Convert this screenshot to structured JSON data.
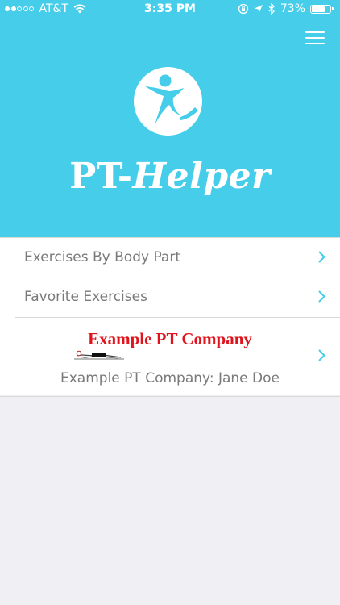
{
  "status_bar": {
    "carrier": "AT&T",
    "signal_bars_filled": 2,
    "signal_bars_total": 5,
    "time": "3:35 PM",
    "battery_percent": "73%",
    "battery_level": 0.73,
    "icons": [
      "wifi-icon",
      "rotation-lock-icon",
      "location-arrow-icon",
      "bluetooth-icon",
      "battery-icon"
    ]
  },
  "header": {
    "title_part_1": "PT-",
    "title_part_2": "Helper",
    "background_color": "#45cdea",
    "menu_icon": "hamburger-menu-icon",
    "logo_icon": "person-figure-logo-icon"
  },
  "menu": {
    "items": [
      {
        "label": "Exercises By Body Part",
        "icon": "chevron-right-icon"
      },
      {
        "label": "Favorite Exercises",
        "icon": "chevron-right-icon"
      }
    ],
    "company": {
      "logo_text": "Example PT Company",
      "label": "Example PT Company: Jane  Doe",
      "logo_color": "#e0141c",
      "icon": "chevron-right-icon"
    }
  },
  "colors": {
    "accent": "#45cdea",
    "chevron": "#45cdea",
    "label_text": "#7a7a7a",
    "background": "#efeff4"
  }
}
